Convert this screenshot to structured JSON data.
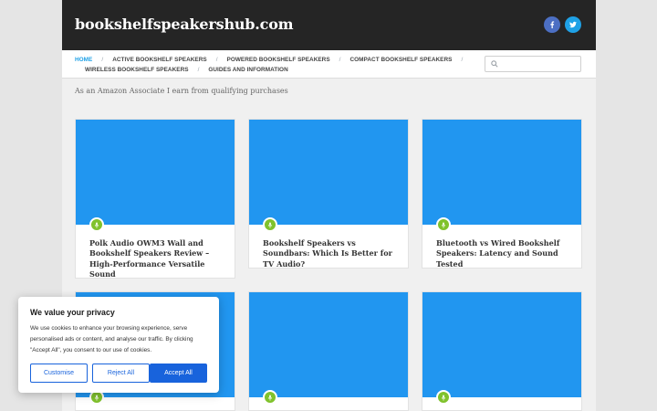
{
  "site": {
    "title": "bookshelfspeakershub.com"
  },
  "social": {
    "facebook_icon": "facebook-icon",
    "twitter_icon": "twitter-icon"
  },
  "nav": {
    "items": [
      {
        "label": "HOME"
      },
      {
        "label": "ACTIVE BOOKSHELF SPEAKERS"
      },
      {
        "label": "POWERED BOOKSHELF SPEAKERS"
      },
      {
        "label": "COMPACT BOOKSHELF SPEAKERS"
      },
      {
        "label": "WIRELESS BOOKSHELF SPEAKERS"
      },
      {
        "label": "GUIDES AND INFORMATION"
      }
    ],
    "separator": "/"
  },
  "search": {
    "placeholder": "",
    "value": ""
  },
  "disclaimer": "As an Amazon Associate I earn from qualifying purchases",
  "posts": [
    {
      "title": "Polk Audio OWM3 Wall and Bookshelf Speakers Review – High-Performance Versatile Sound"
    },
    {
      "title": "Bookshelf Speakers vs Soundbars: Which Is Better for TV Audio?"
    },
    {
      "title": "Bluetooth vs Wired Bookshelf Speakers: Latency and Sound Tested"
    },
    {
      "title": ""
    },
    {
      "title": ""
    },
    {
      "title": ""
    }
  ],
  "cookie": {
    "title": "We value your privacy",
    "text": "We use cookies to enhance your browsing experience, serve personalised ads or content, and analyse our traffic. By clicking \"Accept All\", you consent to our use of cookies.",
    "customise": "Customise",
    "reject": "Reject All",
    "accept": "Accept All"
  },
  "colors": {
    "header_bg": "#252525",
    "accent_blue": "#1fa1e6",
    "thumb_blue": "#2196f0",
    "badge_green": "#80c22c",
    "cookie_blue": "#1863dc"
  }
}
